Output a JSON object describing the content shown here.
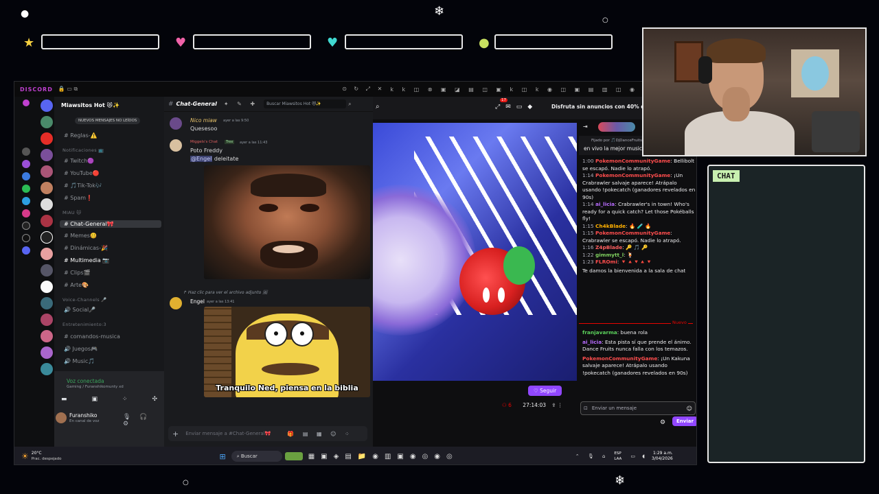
{
  "overlay": {
    "chat_label": "CHAT",
    "slot_colors": [
      "#f5d040",
      "#f062a8",
      "#40d8d0",
      "#c8e060"
    ]
  },
  "discord": {
    "title": "DISCORD",
    "server_name": "Miawsitos Hot 😻✨",
    "unread_banner": "NUEVOS MENSAJES NO LEÍDOS",
    "channels_top": [
      {
        "name": "Reglas-⚠️"
      }
    ],
    "categories": {
      "notificaciones": "Notificaciones 📺",
      "main": "MIAU 🐱",
      "voice": "Voice-Channels 🎤",
      "entretenimiento": "Entretenimiento:3"
    },
    "channels_notif": [
      "Twitch🟣",
      "YouTube🔴",
      "🎵Tik-Tok🎶",
      "Spam❗"
    ],
    "channels_main": [
      "Chat-General🎀",
      "Memes🥴",
      "Dinámicas-🎉",
      "Multimedia 📷",
      "Clips🎬",
      "Arte🎨"
    ],
    "channels_voice": [
      "Social🎤"
    ],
    "channels_ent": [
      "comandos-musica",
      "Juegos🎮",
      "Music🎵"
    ],
    "voice_status": "Voz conectada",
    "voice_channel": "Gaming / Furanshikomunty xd",
    "user_name": "Furanshiko",
    "user_status": "En canal de voz",
    "chat_header": "Chat-General",
    "search_placeholder": "Buscar Miawsitos Hot 😻✨",
    "messages": [
      {
        "author": "Nico miaw",
        "time": "ayer a las 9:50",
        "text": "Quesesoo"
      },
      {
        "author": "Miggels's Chat",
        "badge": "Tree",
        "time": "ayer a las 11:43",
        "text": "Poto Freddy",
        "mention": "@Engel",
        "mention_text": "deleitate"
      },
      {
        "author": "Engel",
        "time": "ayer a las 13:41",
        "reply": "Haz clic para ver el archivo adjunto",
        "caption": "Tranquilo Ned, piensa en la biblia"
      }
    ],
    "input_placeholder": "Enviar mensaje a #Chat-General🎀"
  },
  "twitch": {
    "ad_text": "Disfruta sin anuncios con 40% d",
    "notif_count": "17",
    "pinned_by": "Fijado por 🎵DjDanceFruits",
    "pinned_text": "en vivo la mejor musica ele...",
    "follow_label": "Seguir",
    "viewers": "6",
    "uptime": "27:14:03",
    "chat_placeholder": "Enviar un mensaje",
    "send_label": "Enviar",
    "new_label": "Nuevo",
    "welcome": "Te damos la bienvenida a la sala de chat",
    "lines": [
      {
        "time": "1:00",
        "name": "PokemonCommunityGame",
        "color": "#ff4d4d",
        "text": "Bellibolt se escapó. Nadie lo atrapó."
      },
      {
        "time": "1:14",
        "name": "PokemonCommunityGame",
        "color": "#ff4d4d",
        "text": "¡Un Crabrawler salvaje aparece! Atrápalo usando !pokecatch (ganadores revelados en 90s)"
      },
      {
        "time": "1:14",
        "name": "ai_licia",
        "color": "#b86bff",
        "text": "Crabrawler's in town! Who's ready for a quick catch? Let those Pokéballs fly!"
      },
      {
        "time": "1:15",
        "name": "Ch4kBlade",
        "color": "#ffb000",
        "text": "🔥 🧪 🔥"
      },
      {
        "time": "1:15",
        "name": "PokemonCommunityGame",
        "color": "#ff4d4d",
        "text": "Crabrawler se escapó. Nadie lo atrapó."
      },
      {
        "time": "1:16",
        "name": "Z4pBlade",
        "color": "#ff6060",
        "text": "🔑 🎵 🔑"
      },
      {
        "time": "1:22",
        "name": "gimmytt_l",
        "color": "#7fcf5f",
        "text": "🍹"
      },
      {
        "time": "1:23",
        "name": "FLROmi",
        "color": "#ff4d4d",
        "text": "🔻🔺🔻🔺🔻"
      }
    ],
    "after": [
      {
        "name": "franjavarma",
        "color": "#5bd15b",
        "text": "buena rola"
      },
      {
        "name": "ai_licia",
        "color": "#b86bff",
        "text": "Esta pista sí que prende el ánimo. Dance Fruits nunca falla con los temazos."
      },
      {
        "name": "PokemonCommunityGame",
        "color": "#ff4d4d",
        "text": "¡Un Kakuna salvaje aparece! Atrápalo usando !pokecatch (ganadores revelados en 90s)"
      }
    ]
  },
  "taskbar": {
    "weather": "20°C",
    "weather_desc": "Prac. despejado",
    "search": "Buscar",
    "lang": "ESP LAA",
    "clock": "1:29 a.m.",
    "date": "3/04/2026"
  }
}
